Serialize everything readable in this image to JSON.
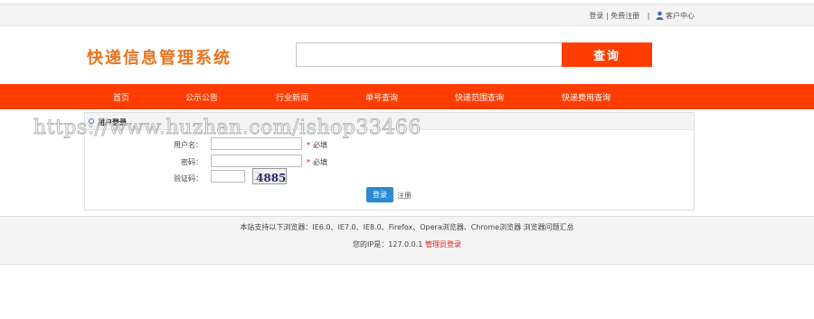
{
  "topbar": {
    "login": "登录",
    "separator": " | ",
    "register": "免费注册",
    "divider": "|",
    "customer_center": "客户中心",
    "user_icon": "user-icon"
  },
  "header": {
    "logo_text": "快递信息管理系统",
    "search_value": "",
    "search_placeholder": "",
    "search_button": "查询"
  },
  "nav": {
    "items": [
      {
        "label": "首页"
      },
      {
        "label": "公示公告"
      },
      {
        "label": "行业新闻"
      },
      {
        "label": "单号查询"
      },
      {
        "label": "快递范围查询"
      },
      {
        "label": "快递费用查询"
      }
    ]
  },
  "login_panel": {
    "title": "用户登录",
    "username_label": "用户名：",
    "username_value": "",
    "username_required": "必填",
    "password_label": "密码：",
    "password_value": "",
    "password_required": "必填",
    "required_mark": "*",
    "captcha_label": "验证码：",
    "captcha_value": "",
    "captcha_image_text": "4885",
    "login_button": "登录",
    "register_link": "注册"
  },
  "watermark": "https://www.huzhan.com/ishop33466",
  "footer": {
    "browser_support": "本站支持以下浏览器：IE6.0、IE7.0、IE8.0、Firefox、Opera浏览器、Chrome浏览器 浏览器问题汇总",
    "ip_prefix": "您的IP是：127.0.0.1",
    "admin_login": "管理员登录"
  },
  "colors": {
    "brand_orange": "#ff3d00",
    "logo_orange": "#e8741e",
    "button_blue": "#2a8ad4",
    "admin_link_red": "#e02020"
  }
}
